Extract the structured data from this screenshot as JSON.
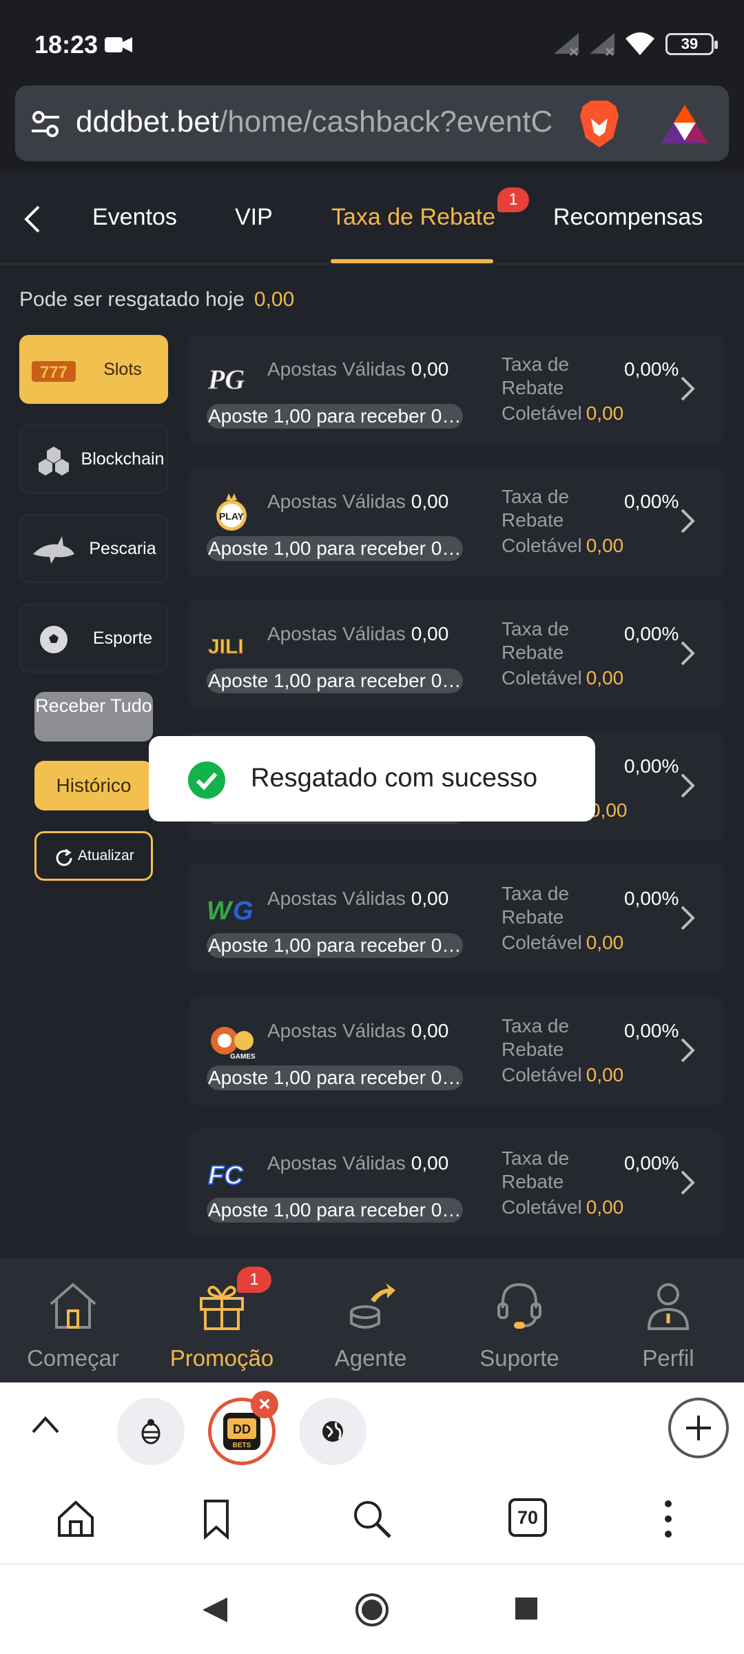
{
  "status": {
    "time": "18:23",
    "battery": "39"
  },
  "browser": {
    "url_host": "dddbet.bet",
    "url_path": "/home/cashback?eventC",
    "tab_count": "70"
  },
  "tabs": {
    "items": [
      {
        "label": "Eventos"
      },
      {
        "label": "VIP"
      },
      {
        "label": "Taxa de Rebate"
      },
      {
        "label": "Recompensas"
      }
    ],
    "active_index": 2,
    "badge": "1"
  },
  "today": {
    "label": "Pode ser resgatado hoje",
    "value": "0,00"
  },
  "categories": [
    {
      "label": "Slots",
      "icon": "slot-777-icon",
      "active": true
    },
    {
      "label": "Blockchain",
      "icon": "blockchain-cubes-icon"
    },
    {
      "label": "Pescaria",
      "icon": "shark-icon"
    },
    {
      "label": "Esporte",
      "icon": "soccer-ball-icon"
    }
  ],
  "actions": {
    "receive_all": "Receber Tudo",
    "history": "Histórico",
    "refresh": "Atualizar"
  },
  "card_labels": {
    "valid_bets": "Apostas Válidas",
    "rate_label": "Taxa de Rebate",
    "collectible": "Coletável"
  },
  "providers": [
    {
      "logo": "pg-logo",
      "valid": "0,00",
      "hint": "Aposte 1,00 para receber 0,...",
      "rate": "0,00%",
      "collectible": "0,00"
    },
    {
      "logo": "play-logo",
      "valid": "0,00",
      "hint": "Aposte 1,00 para receber 0,...",
      "rate": "0,00%",
      "collectible": "0,00"
    },
    {
      "logo": "jili-logo",
      "valid": "0,00",
      "hint": "Aposte 1,00 para receber 0,...",
      "rate": "0,00%",
      "collectible": "0,00"
    },
    {
      "logo": "hidden-logo",
      "valid": "",
      "hint": "",
      "rate": "0,00%",
      "collectible": "0,00"
    },
    {
      "logo": "wg-logo",
      "valid": "0,00",
      "hint": "Aposte 1,00 para receber 0,...",
      "rate": "0,00%",
      "collectible": "0,00"
    },
    {
      "logo": "cq9-logo",
      "valid": "0,00",
      "hint": "Aposte 1,00 para receber 0,...",
      "rate": "0,00%",
      "collectible": "0,00"
    },
    {
      "logo": "fc-logo",
      "valid": "0,00",
      "hint": "Aposte 1,00 para receber 0,...",
      "rate": "0,00%",
      "collectible": "0,00"
    }
  ],
  "toast": {
    "message": "Resgatado com sucesso"
  },
  "bottom_nav": {
    "items": [
      {
        "label": "Começar",
        "icon": "home-icon"
      },
      {
        "label": "Promoção",
        "icon": "gift-icon"
      },
      {
        "label": "Agente",
        "icon": "agent-coins-icon"
      },
      {
        "label": "Suporte",
        "icon": "headset-icon"
      },
      {
        "label": "Perfil",
        "icon": "profile-icon"
      }
    ],
    "active_index": 1,
    "badge": "1"
  },
  "colors": {
    "accent": "#f2b84b",
    "background": "#202329",
    "card": "#25282e",
    "badge": "#e5413a"
  }
}
